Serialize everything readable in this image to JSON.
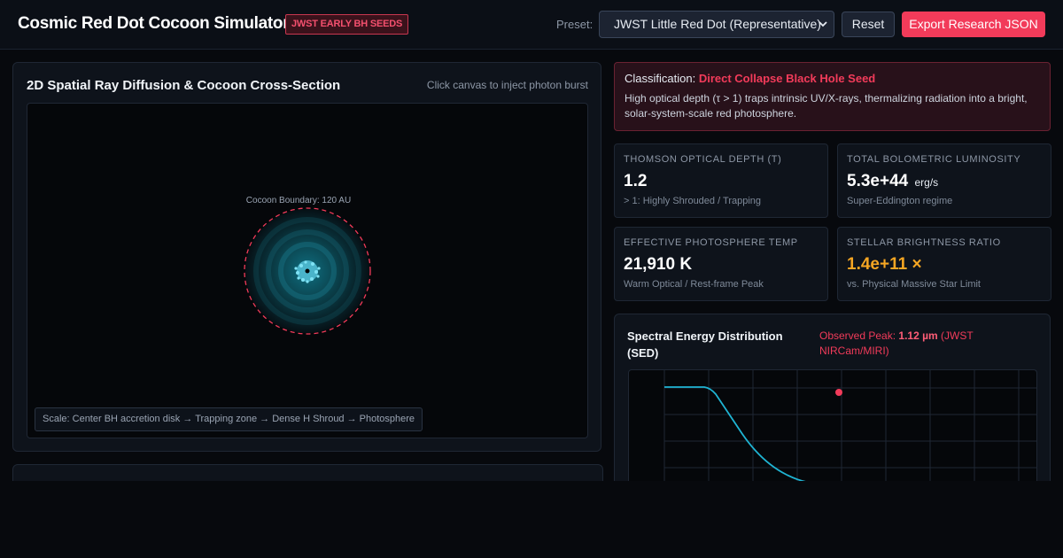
{
  "header": {
    "title": "Cosmic Red Dot Cocoon Simulator",
    "badge": "JWST EARLY BH SEEDS",
    "preset_label": "Preset:",
    "preset_value": "JWST Little Red Dot (Representative)",
    "reset_label": "Reset",
    "export_label": "Export Research JSON"
  },
  "diffusion_panel": {
    "title": "2D Spatial Ray Diffusion & Cocoon Cross-Section",
    "hint": "Click canvas to inject photon burst",
    "boundary_label": "Cocoon Boundary: 120 AU",
    "scale_note": "Scale: Center BH accretion disk → Trapping zone → Dense H Shroud → Photosphere"
  },
  "classification": {
    "prefix": "Classification:",
    "value": "Direct Collapse Black Hole Seed",
    "description": "High optical depth (τ > 1) traps intrinsic UV/X-rays, thermalizing radiation into a bright, solar-system-scale red photosphere."
  },
  "metrics": [
    {
      "label": "THOMSON OPTICAL DEPTH (Τ)",
      "value": "1.2",
      "unit": "",
      "sub": "> 1: Highly Shrouded / Trapping"
    },
    {
      "label": "TOTAL BOLOMETRIC LUMINOSITY",
      "value": "5.3e+44",
      "unit": "erg/s",
      "sub": "Super-Eddington regime"
    },
    {
      "label": "EFFECTIVE PHOTOSPHERE TEMP",
      "value": "21,910 K",
      "unit": "",
      "sub": "Warm Optical / Rest-frame Peak"
    },
    {
      "label": "STELLAR BRIGHTNESS RATIO",
      "value": "1.4e+11 ×",
      "unit": "",
      "sub": "vs. Physical Massive Star Limit"
    }
  ],
  "sed": {
    "title": "Spectral Energy Distribution (SED)",
    "peak_prefix": "Observed Peak:",
    "peak_value": "1.12 µm",
    "peak_suffix": "(JWST NIRCam/MIRI)"
  },
  "colors": {
    "accent": "#f23b5a",
    "warning": "#f5a623",
    "curve": "#1fb4d3"
  }
}
